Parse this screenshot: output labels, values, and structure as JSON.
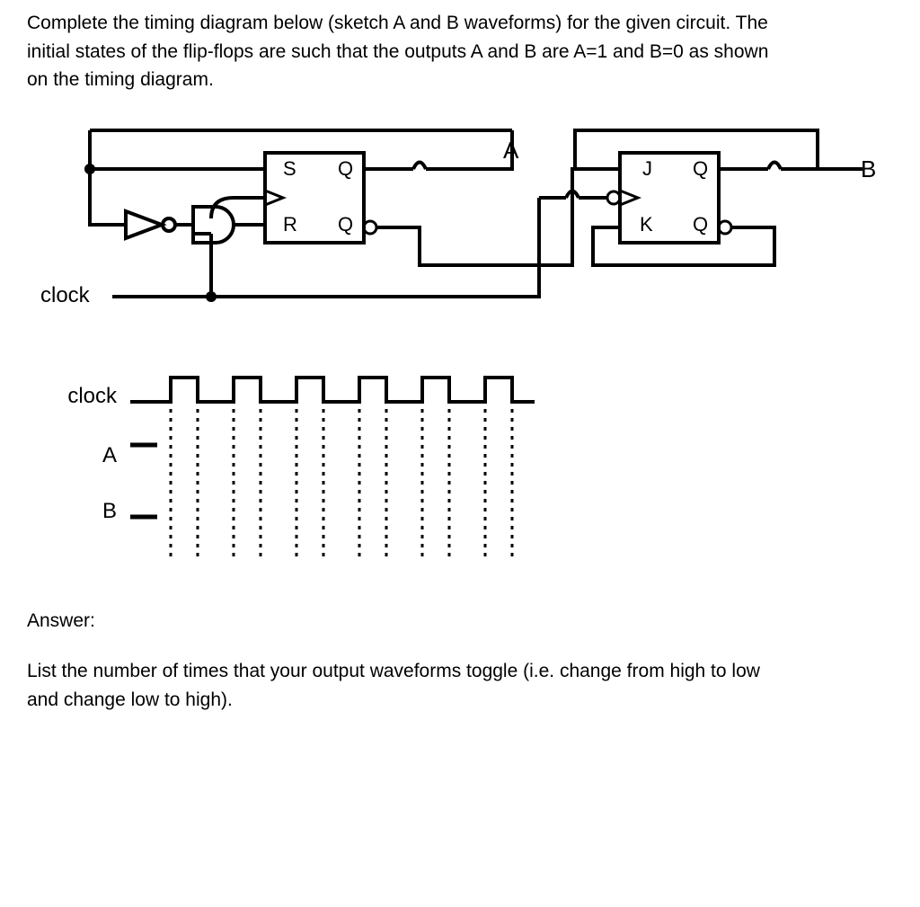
{
  "question": {
    "line1": "Complete the timing diagram below (sketch A and B waveforms) for the given circuit.  The",
    "line2": "initial states of the flip-flops are such that the outputs A and B are A=1 and B=0 as shown",
    "line3": "on the timing diagram."
  },
  "circuit": {
    "clock_label": "clock",
    "sr_flipflop": {
      "s": "S",
      "r": "R",
      "q": "Q",
      "qbar": "Q"
    },
    "jk_flipflop": {
      "j": "J",
      "k": "K",
      "q": "Q",
      "qbar": "Q"
    },
    "output_a": "A",
    "output_b": "B"
  },
  "timing": {
    "clock_label": "clock",
    "signal_a": "A",
    "signal_b": "B"
  },
  "answer": {
    "heading": "Answer:",
    "prompt_line1": "List the number of times that your output waveforms toggle (i.e. change from high to low",
    "prompt_line2": "and change low to high)."
  }
}
